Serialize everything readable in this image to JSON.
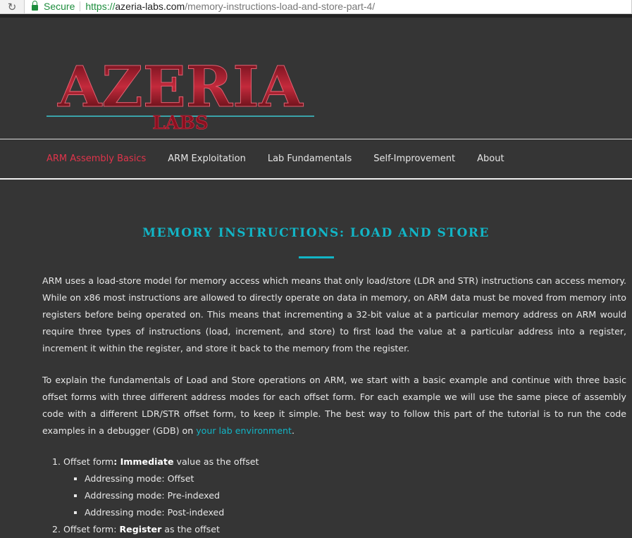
{
  "browser": {
    "secure_label": "Secure",
    "url_scheme": "https://",
    "url_host": "azeria-labs.com",
    "url_path": "/memory-instructions-load-and-store-part-4/"
  },
  "logo": {
    "text": "AZERIA",
    "sub": "LABS"
  },
  "nav": {
    "items": [
      {
        "label": "ARM Assembly Basics",
        "active": true
      },
      {
        "label": "ARM Exploitation"
      },
      {
        "label": "Lab Fundamentals"
      },
      {
        "label": "Self-Improvement"
      },
      {
        "label": "About"
      }
    ]
  },
  "article": {
    "title": "MEMORY INSTRUCTIONS: LOAD AND STORE",
    "p1": "ARM uses a load-store model for memory access which means that only load/store (LDR and STR) instructions can access memory. While on x86 most instructions are allowed to directly operate on data in memory, on ARM data must be moved from memory into registers before being operated on. This means that incrementing a 32-bit value at a particular memory address on ARM would require three types of instructions (load, increment, and store) to first load the value at a particular address into a register, increment it within the register, and store it back to the memory from the register.",
    "p2_text": "To explain the fundamentals of Load and Store operations on ARM, we start with a basic example and continue with three basic offset forms with three different address modes for each offset form. For each example we will use the same piece of assembly code with a different LDR/STR offset form, to keep it simple. The best way to follow this part of the tutorial is to run the code examples in a debugger (GDB) on ",
    "p2_link": "your lab environment",
    "p2_end": ".",
    "list": [
      {
        "prefix": "Offset form",
        "bold": ": Immediate",
        "suffix": " value as the offset",
        "sub": [
          "Addressing mode: Offset",
          "Addressing mode: Pre-indexed",
          "Addressing mode: Post-indexed"
        ]
      },
      {
        "prefix": "Offset form: ",
        "bold": "Register",
        "suffix": " as the offset"
      }
    ]
  },
  "colors": {
    "accent": "#12b5c6",
    "active_nav": "#e0344b",
    "background": "#353535"
  }
}
